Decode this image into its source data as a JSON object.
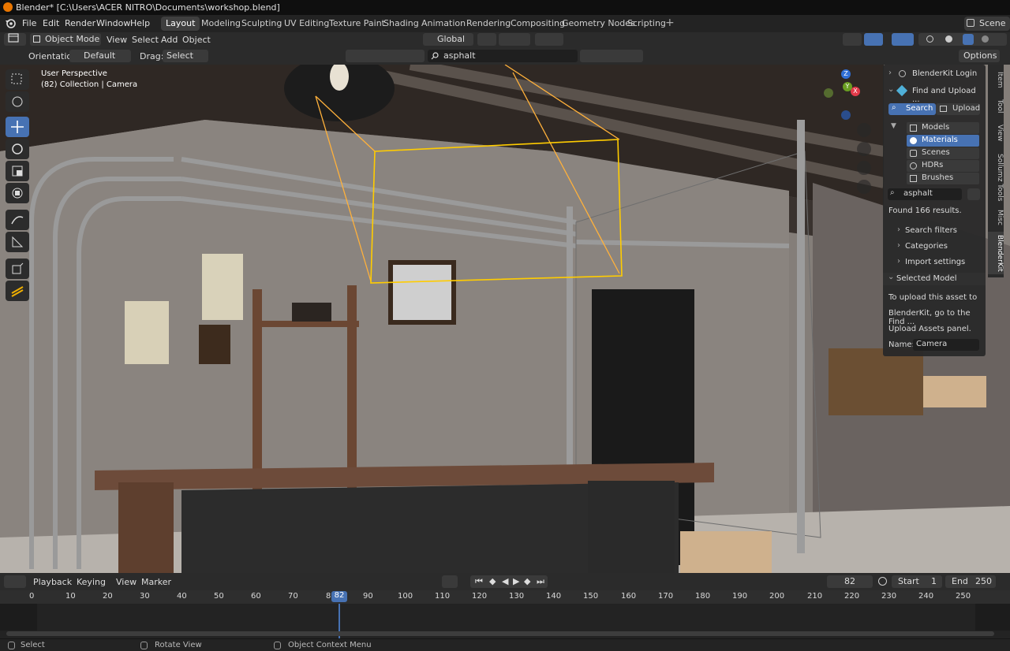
{
  "window": {
    "title": "Blender* [C:\\Users\\ACER NITRO\\Documents\\workshop.blend]"
  },
  "menu": [
    "File",
    "Edit",
    "Render",
    "Window",
    "Help"
  ],
  "workspaces": [
    "Layout",
    "Modeling",
    "Sculpting",
    "UV Editing",
    "Texture Paint",
    "Shading",
    "Animation",
    "Rendering",
    "Compositing",
    "Geometry Nodes",
    "Scripting"
  ],
  "active_workspace": "Layout",
  "scene_name": "Scene",
  "header": {
    "mode": "Object Mode",
    "view": "View",
    "select": "Select",
    "add": "Add",
    "object": "Object",
    "transform_orientation": "Global",
    "orientation_label": "Orientation:",
    "orientation_value": "Default",
    "drag_label": "Drag:",
    "drag_value": "Select Box",
    "search_value": "asphalt",
    "options": "Options"
  },
  "viewport": {
    "overlay_line1": "User Perspective",
    "overlay_line2": "(82) Collection | Camera"
  },
  "npanel": {
    "login": "BlenderKit Login",
    "find_upload": "Find and Upload ...",
    "search_tab": "Search",
    "upload_tab": "Upload",
    "asset_types": [
      "Models",
      "Materials",
      "Scenes",
      "HDRs",
      "Brushes"
    ],
    "selected_asset_type": "Materials",
    "search_value": "asphalt",
    "results": "Found 166 results.",
    "search_filters": "Search filters",
    "categories": "Categories",
    "import_settings": "Import settings",
    "selected_model": "Selected Model",
    "upload_msg_1": "To upload this asset to",
    "upload_msg_2": "BlenderKit, go to the Find ...",
    "upload_msg_3": "Upload Assets panel.",
    "name_label": "Name:",
    "name_value": "Camera"
  },
  "side_tabs": [
    "Item",
    "Tool",
    "View",
    "Sollumz Tools",
    "Misc",
    "BlenderKit"
  ],
  "timeline": {
    "menu": [
      "Playback",
      "Keying",
      "View",
      "Marker"
    ],
    "current_frame": "82",
    "start_label": "Start",
    "start_value": "1",
    "end_label": "End",
    "end_value": "250",
    "ruler": [
      "0",
      "10",
      "20",
      "30",
      "40",
      "50",
      "60",
      "70",
      "8",
      "82",
      "90",
      "100",
      "110",
      "120",
      "130",
      "140",
      "150",
      "160",
      "170",
      "180",
      "190",
      "200",
      "210",
      "220",
      "230",
      "240",
      "250"
    ]
  },
  "status": {
    "select": "Select",
    "rotate": "Rotate View",
    "context": "Object Context Menu"
  },
  "colors": {
    "accent": "#4772b3",
    "orange": "#ea7600",
    "selection": "#ffcc00"
  }
}
